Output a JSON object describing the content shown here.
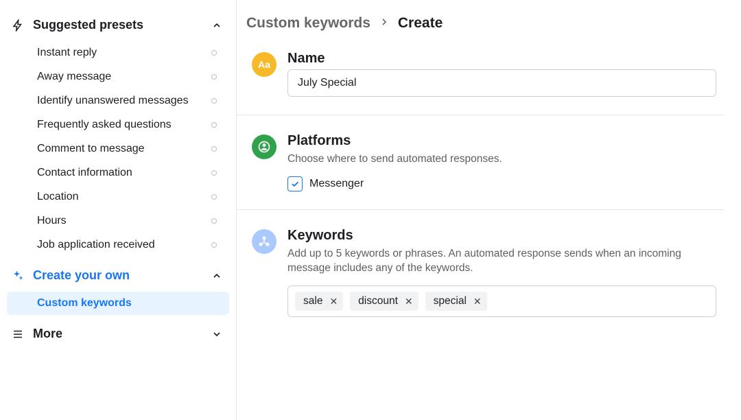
{
  "sidebar": {
    "suggested": {
      "title": "Suggested presets",
      "items": [
        {
          "label": "Instant reply"
        },
        {
          "label": "Away message"
        },
        {
          "label": "Identify unanswered messages"
        },
        {
          "label": "Frequently asked questions"
        },
        {
          "label": "Comment to message"
        },
        {
          "label": "Contact information"
        },
        {
          "label": "Location"
        },
        {
          "label": "Hours"
        },
        {
          "label": "Job application received"
        }
      ]
    },
    "create": {
      "title": "Create your own",
      "items": [
        {
          "label": "Custom keywords"
        }
      ]
    },
    "more": {
      "title": "More"
    }
  },
  "breadcrumb": {
    "parent": "Custom keywords",
    "current": "Create"
  },
  "name_section": {
    "title": "Name",
    "value": "July Special"
  },
  "platforms_section": {
    "title": "Platforms",
    "subtitle": "Choose where to send automated responses.",
    "options": [
      {
        "label": "Messenger",
        "checked": true
      }
    ]
  },
  "keywords_section": {
    "title": "Keywords",
    "subtitle": "Add up to 5 keywords or phrases. An automated response sends when an incoming message includes any of the keywords.",
    "tags": [
      "sale",
      "discount",
      "special"
    ]
  }
}
